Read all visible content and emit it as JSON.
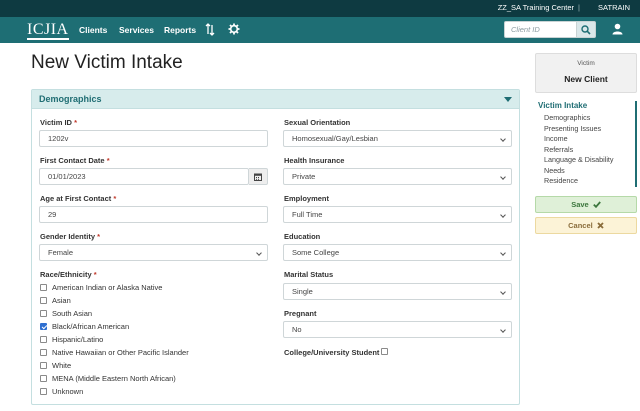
{
  "top_bar": {
    "organization": "ZZ_SA Training Center",
    "separator": "|",
    "user": "SATRAIN"
  },
  "nav": {
    "logo_text": "ICJIA",
    "links": [
      "Clients",
      "Services",
      "Reports"
    ],
    "icons": [
      "sort-arrows-icon",
      "gear-icon",
      "search-icon",
      "user-icon"
    ],
    "search_placeholder": "Client ID"
  },
  "page": {
    "title": "New Victim Intake"
  },
  "demographics": {
    "title": "Demographics",
    "victim_id": {
      "label": "Victim ID",
      "required_mark": "*",
      "value": "1202v"
    },
    "first_contact_date": {
      "label": "First Contact Date",
      "required_mark": "*",
      "value": "01/01/2023"
    },
    "age_at_first_contact": {
      "label": "Age at First Contact",
      "required_mark": "*",
      "value": "29"
    },
    "gender_identity": {
      "label": "Gender Identity",
      "required_mark": "*",
      "value": "Female"
    },
    "race_ethnicity": {
      "label": "Race/Ethnicity",
      "required_mark": "*",
      "options": [
        {
          "label": "American Indian or Alaska Native",
          "checked": false
        },
        {
          "label": "Asian",
          "checked": false
        },
        {
          "label": "South Asian",
          "checked": false
        },
        {
          "label": "Black/African American",
          "checked": true
        },
        {
          "label": "Hispanic/Latino",
          "checked": false
        },
        {
          "label": "Native Hawaiian or Other Pacific Islander",
          "checked": false
        },
        {
          "label": "White",
          "checked": false
        },
        {
          "label": "MENA (Middle Eastern North African)",
          "checked": false
        },
        {
          "label": "Unknown",
          "checked": false
        }
      ]
    },
    "sexual_orientation": {
      "label": "Sexual Orientation",
      "value": "Homosexual/Gay/Lesbian"
    },
    "health_insurance": {
      "label": "Health Insurance",
      "value": "Private"
    },
    "employment": {
      "label": "Employment",
      "value": "Full Time"
    },
    "education": {
      "label": "Education",
      "value": "Some College"
    },
    "marital_status": {
      "label": "Marital Status",
      "value": "Single"
    },
    "pregnant": {
      "label": "Pregnant",
      "value": "No"
    },
    "college_student": {
      "label": "College/University Student",
      "checked": false
    }
  },
  "sidebar": {
    "card_small": "Victim",
    "card_big": "New Client",
    "nav_heading": "Victim Intake",
    "nav_items": [
      "Demographics",
      "Presenting Issues",
      "Income",
      "Referrals",
      "Language & Disability",
      "Needs",
      "Residence"
    ],
    "save_label": "Save",
    "cancel_label": "Cancel"
  },
  "colors": {
    "top_strip": "#0e3a41",
    "navbar": "#1e6e74",
    "panel_header": "#d7ecec",
    "accent": "#1f6d73",
    "required": "#c0392b",
    "save_bg": "#dff0d8",
    "cancel_bg": "#fcf3d7"
  }
}
